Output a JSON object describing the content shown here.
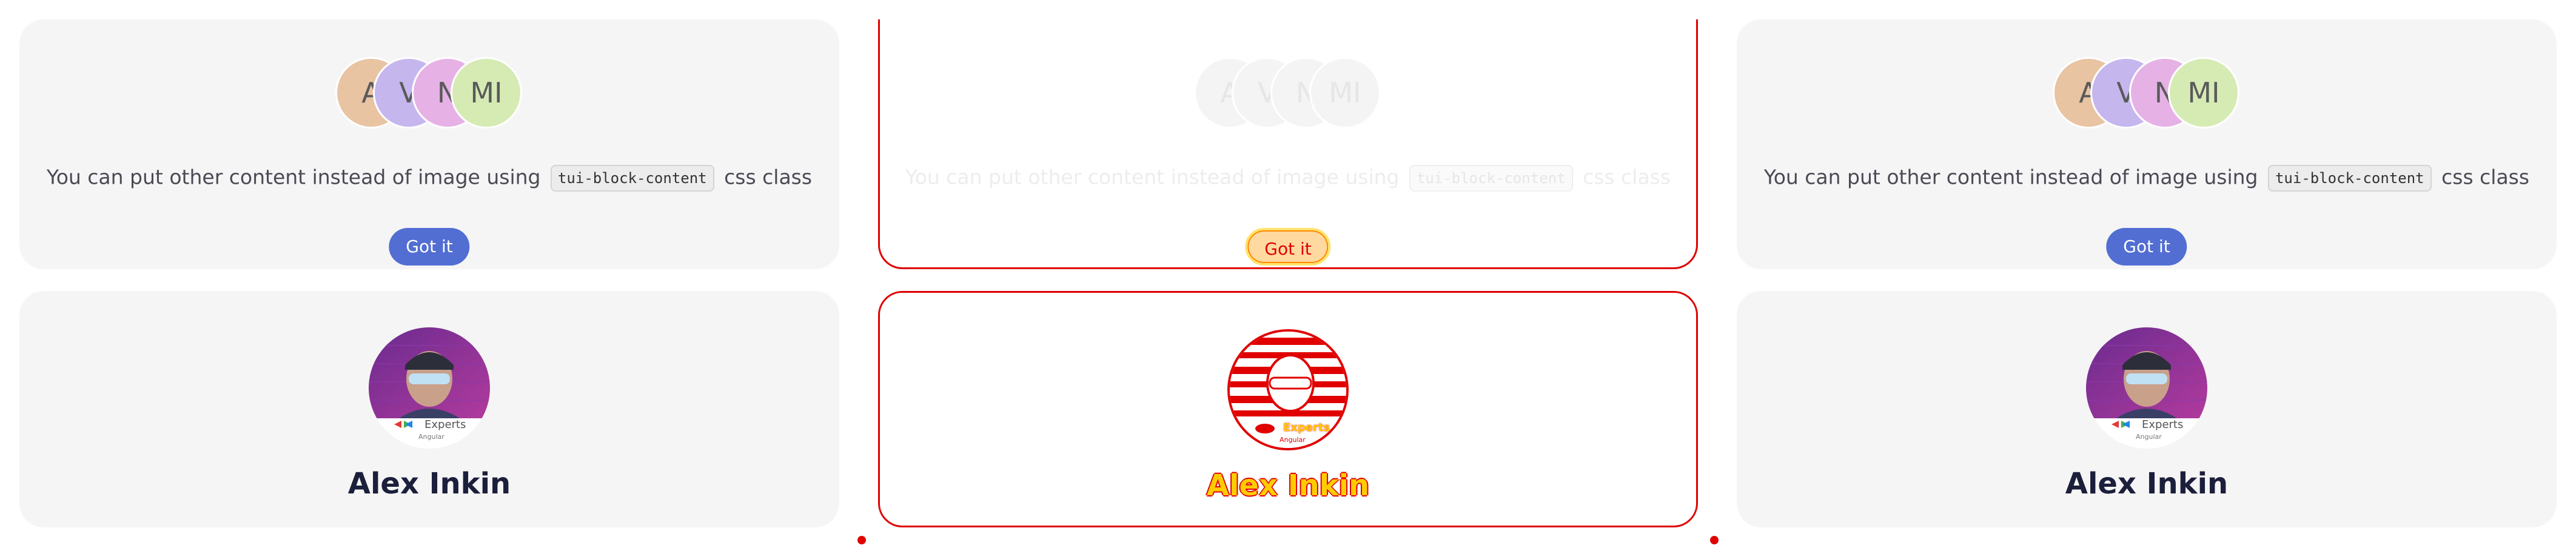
{
  "block_card": {
    "avatars": [
      "A",
      "V",
      "N",
      "MI"
    ],
    "text_before": "You can put other content instead of image using",
    "code": "tui-block-content",
    "text_after": "css class",
    "button_label": "Got it"
  },
  "profile_card": {
    "name": "Alex Inkin",
    "badge_text": "Experts",
    "badge_sub": "Angular"
  },
  "colors": {
    "card_bg": "#f5f5f5",
    "primary": "#526ed3",
    "title": "#1b1f3b",
    "highlight_red": "#e00000",
    "highlight_yellow": "#ffcc00"
  }
}
